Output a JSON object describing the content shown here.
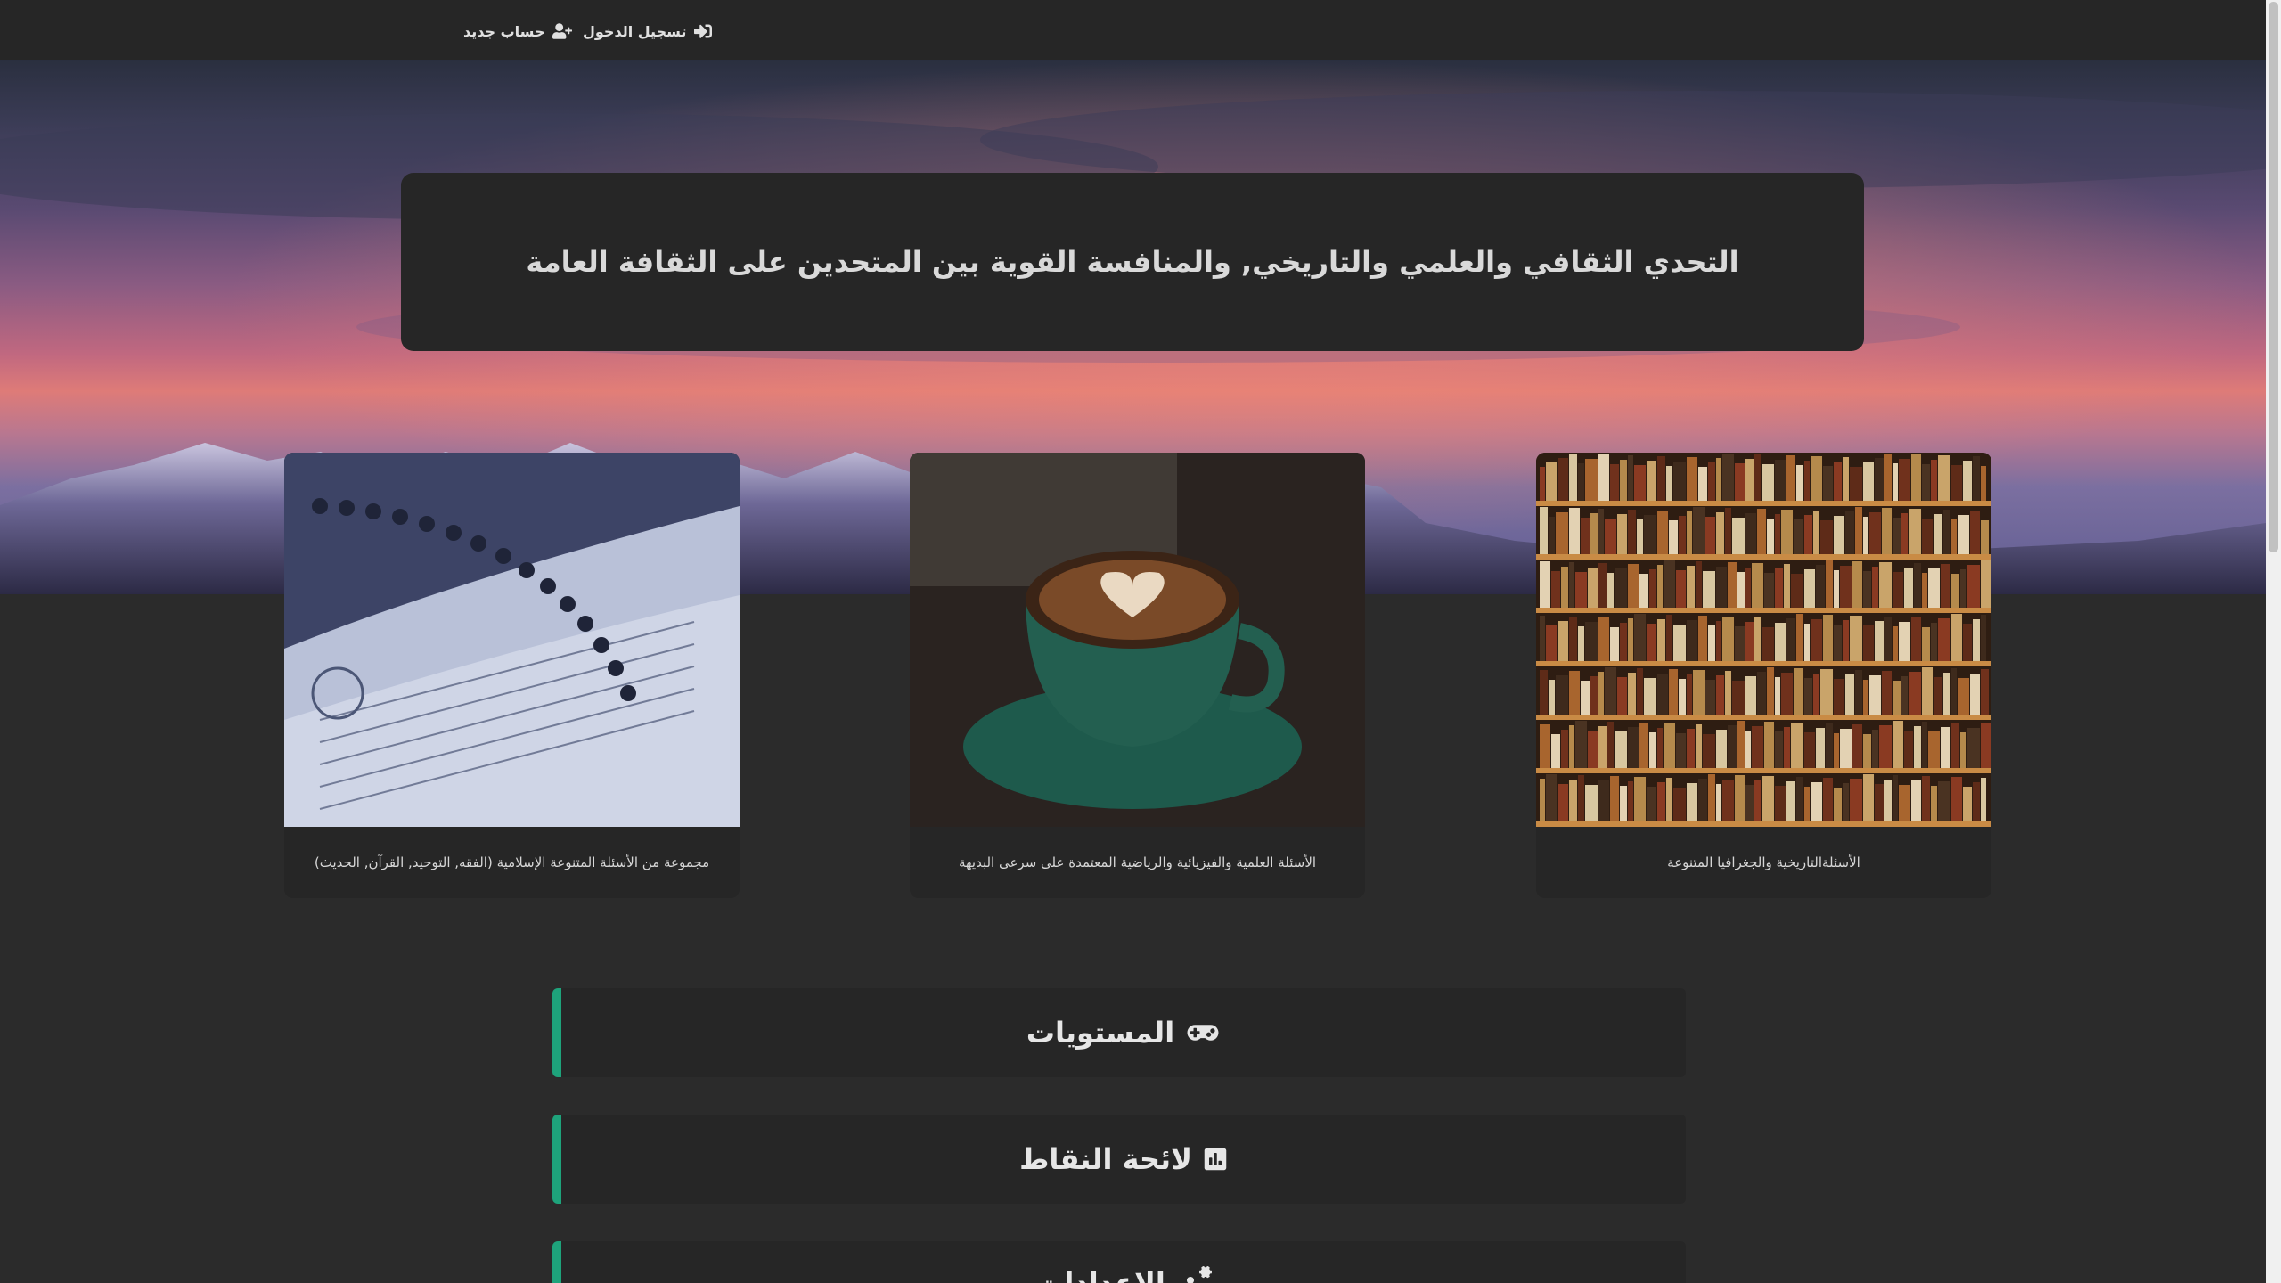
{
  "nav": {
    "login_label": "تسجيل الدخول",
    "register_label": "حساب جديد"
  },
  "hero": {
    "title": "التحدي الثقافي والعلمي والتاريخي, والمنافسة القوية بين المتحدين على الثقافة العامة"
  },
  "cards": [
    {
      "id": "islam",
      "text": "مجموعة من الأسئلة المتنوعة الإسلامية (الفقه, التوحيد, القرآن, الحديث)",
      "image": "quran-with-prayer-beads"
    },
    {
      "id": "science",
      "text": "الأسئلة العلمية والفيزيائية والرياضية المعتمدة على سرعى البديهة",
      "image": "coffee-cup"
    },
    {
      "id": "history",
      "text": "الأسئلةالتاريخية والجغرافيا المتنوعة",
      "image": "bookshelf"
    }
  ],
  "menu": {
    "levels_label": "المستويات",
    "scores_label": "لائحة النقاط",
    "settings_label": "الإعدادات"
  },
  "colors": {
    "accent": "#1ea37b",
    "panel": "#262626",
    "page": "#2b2b2b"
  },
  "icons": {
    "login": "sign-in-icon",
    "register": "user-plus-icon",
    "levels": "gamepad-icon",
    "scores": "bar-chart-icon",
    "settings": "gears-icon"
  }
}
